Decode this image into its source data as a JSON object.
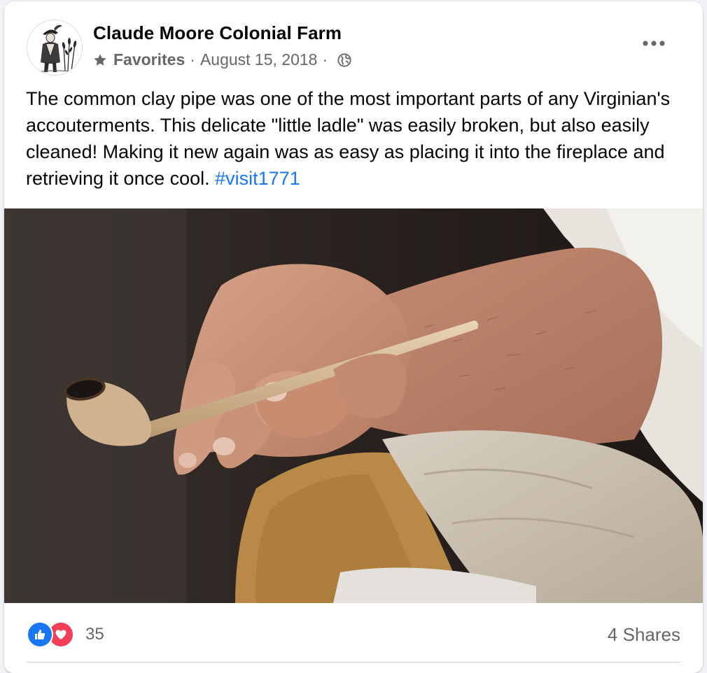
{
  "post": {
    "page_name": "Claude Moore Colonial Farm",
    "audience_label": "Favorites",
    "separator": "·",
    "date": "August 15, 2018",
    "text": "The common clay pipe was one of the most important parts of any Virginian's accouterments. This delicate \"little ladle\" was easily broken, but also easily cleaned! Making it new again was as easy as placing it into the fireplace and retrieving it once cool.",
    "hashtag": "#visit1771"
  },
  "icons": {
    "avatar": "colonial-figure-logo",
    "audience": "star-icon",
    "privacy": "globe-icon",
    "menu": "more-options-icon",
    "reaction_1": "like-icon",
    "reaction_2": "love-icon"
  },
  "photo": {
    "subject": "hand holding a clay pipe"
  },
  "footer": {
    "reaction_count": "35",
    "shares": "4 Shares"
  },
  "colors": {
    "link": "#1877f2",
    "like": "#1877f2",
    "love": "#f33e58",
    "secondary_text": "#65676b",
    "primary_text": "#050505"
  }
}
